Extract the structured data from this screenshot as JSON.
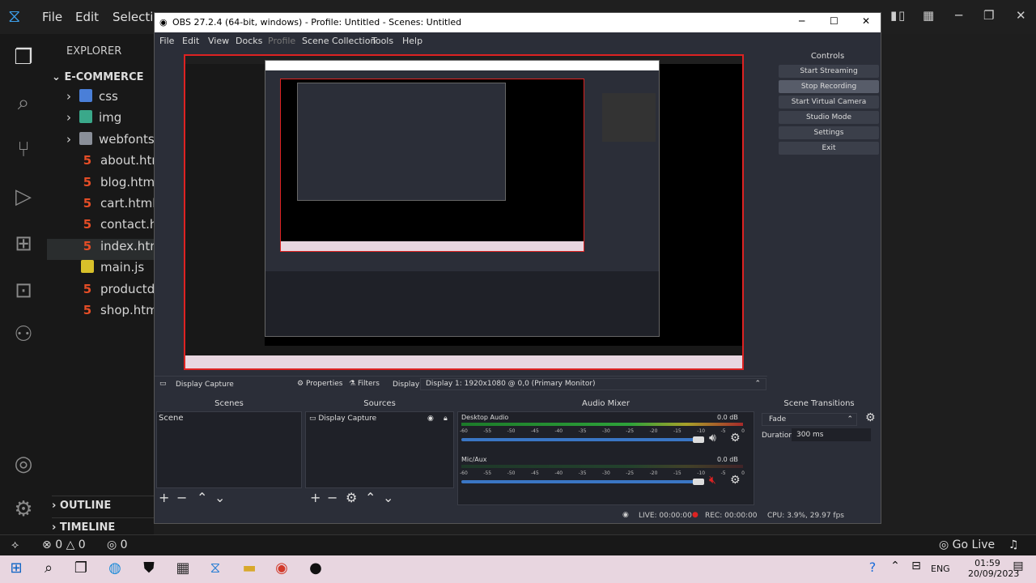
{
  "vscode": {
    "menu": [
      "File",
      "Edit",
      "Selectic"
    ],
    "explorer_title": "EXPLORER",
    "project": "E-COMMERCE",
    "tree": [
      {
        "name": "css",
        "kind": "folder"
      },
      {
        "name": "img",
        "kind": "folder"
      },
      {
        "name": "webfonts",
        "kind": "folder"
      },
      {
        "name": "about.htm",
        "kind": "html"
      },
      {
        "name": "blog.html",
        "kind": "html"
      },
      {
        "name": "cart.html",
        "kind": "html"
      },
      {
        "name": "contact.ht",
        "kind": "html"
      },
      {
        "name": "index.htm",
        "kind": "html"
      },
      {
        "name": "main.js",
        "kind": "js"
      },
      {
        "name": "productd",
        "kind": "html"
      },
      {
        "name": "shop.htm",
        "kind": "html"
      }
    ],
    "outline": "OUTLINE",
    "timeline": "TIMELINE",
    "status": {
      "errors": "0",
      "warnings": "0",
      "ports": "0",
      "go_live": "Go Live"
    }
  },
  "obs": {
    "title": "OBS 27.2.4 (64-bit, windows) - Profile: Untitled - Scenes: Untitled",
    "menu": [
      "File",
      "Edit",
      "View",
      "Docks",
      "Profile",
      "Scene Collection",
      "Tools",
      "Help"
    ],
    "controls_title": "Controls",
    "controls": [
      "Start Streaming",
      "Stop Recording",
      "Start Virtual Camera",
      "Studio Mode",
      "Settings",
      "Exit"
    ],
    "source_bar": {
      "name": "Display Capture",
      "properties": "Properties",
      "filters": "Filters",
      "display_label": "Display",
      "display_value": "Display 1: 1920x1080 @ 0,0 (Primary Monitor)"
    },
    "scenes_title": "Scenes",
    "scene_item": "Scene",
    "sources_title": "Sources",
    "source_item": "Display Capture",
    "mixer_title": "Audio Mixer",
    "mixer": [
      {
        "name": "Desktop Audio",
        "db": "0.0 dB",
        "level": 0.72
      },
      {
        "name": "Mic/Aux",
        "db": "0.0 dB",
        "level": 0.0
      }
    ],
    "mixer_ticks": [
      "-60",
      "-55",
      "-50",
      "-45",
      "-40",
      "-35",
      "-30",
      "-25",
      "-20",
      "-15",
      "-10",
      "-5",
      "0"
    ],
    "transitions_title": "Scene Transitions",
    "transition": "Fade",
    "duration_label": "Duration",
    "duration_value": "300 ms",
    "status": {
      "live": "LIVE: 00:00:00",
      "rec": "REC: 00:00:00",
      "cpu": "CPU: 3.9%, 29.97 fps"
    }
  },
  "taskbar": {
    "lang": "ENG",
    "time": "01:59",
    "date": "20/09/2023"
  }
}
